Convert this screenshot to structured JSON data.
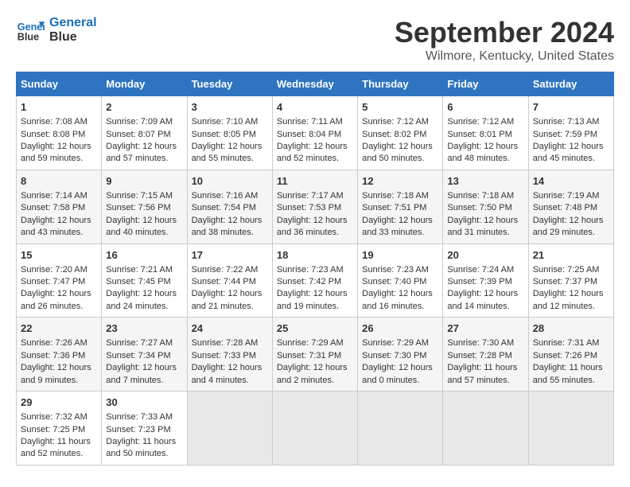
{
  "logo": {
    "line1": "General",
    "line2": "Blue"
  },
  "title": "September 2024",
  "subtitle": "Wilmore, Kentucky, United States",
  "headers": [
    "Sunday",
    "Monday",
    "Tuesday",
    "Wednesday",
    "Thursday",
    "Friday",
    "Saturday"
  ],
  "weeks": [
    [
      {
        "day": "1",
        "sunrise": "7:08 AM",
        "sunset": "8:08 PM",
        "daylight": "12 hours and 59 minutes."
      },
      {
        "day": "2",
        "sunrise": "7:09 AM",
        "sunset": "8:07 PM",
        "daylight": "12 hours and 57 minutes."
      },
      {
        "day": "3",
        "sunrise": "7:10 AM",
        "sunset": "8:05 PM",
        "daylight": "12 hours and 55 minutes."
      },
      {
        "day": "4",
        "sunrise": "7:11 AM",
        "sunset": "8:04 PM",
        "daylight": "12 hours and 52 minutes."
      },
      {
        "day": "5",
        "sunrise": "7:12 AM",
        "sunset": "8:02 PM",
        "daylight": "12 hours and 50 minutes."
      },
      {
        "day": "6",
        "sunrise": "7:12 AM",
        "sunset": "8:01 PM",
        "daylight": "12 hours and 48 minutes."
      },
      {
        "day": "7",
        "sunrise": "7:13 AM",
        "sunset": "7:59 PM",
        "daylight": "12 hours and 45 minutes."
      }
    ],
    [
      {
        "day": "8",
        "sunrise": "7:14 AM",
        "sunset": "7:58 PM",
        "daylight": "12 hours and 43 minutes."
      },
      {
        "day": "9",
        "sunrise": "7:15 AM",
        "sunset": "7:56 PM",
        "daylight": "12 hours and 40 minutes."
      },
      {
        "day": "10",
        "sunrise": "7:16 AM",
        "sunset": "7:54 PM",
        "daylight": "12 hours and 38 minutes."
      },
      {
        "day": "11",
        "sunrise": "7:17 AM",
        "sunset": "7:53 PM",
        "daylight": "12 hours and 36 minutes."
      },
      {
        "day": "12",
        "sunrise": "7:18 AM",
        "sunset": "7:51 PM",
        "daylight": "12 hours and 33 minutes."
      },
      {
        "day": "13",
        "sunrise": "7:18 AM",
        "sunset": "7:50 PM",
        "daylight": "12 hours and 31 minutes."
      },
      {
        "day": "14",
        "sunrise": "7:19 AM",
        "sunset": "7:48 PM",
        "daylight": "12 hours and 29 minutes."
      }
    ],
    [
      {
        "day": "15",
        "sunrise": "7:20 AM",
        "sunset": "7:47 PM",
        "daylight": "12 hours and 26 minutes."
      },
      {
        "day": "16",
        "sunrise": "7:21 AM",
        "sunset": "7:45 PM",
        "daylight": "12 hours and 24 minutes."
      },
      {
        "day": "17",
        "sunrise": "7:22 AM",
        "sunset": "7:44 PM",
        "daylight": "12 hours and 21 minutes."
      },
      {
        "day": "18",
        "sunrise": "7:23 AM",
        "sunset": "7:42 PM",
        "daylight": "12 hours and 19 minutes."
      },
      {
        "day": "19",
        "sunrise": "7:23 AM",
        "sunset": "7:40 PM",
        "daylight": "12 hours and 16 minutes."
      },
      {
        "day": "20",
        "sunrise": "7:24 AM",
        "sunset": "7:39 PM",
        "daylight": "12 hours and 14 minutes."
      },
      {
        "day": "21",
        "sunrise": "7:25 AM",
        "sunset": "7:37 PM",
        "daylight": "12 hours and 12 minutes."
      }
    ],
    [
      {
        "day": "22",
        "sunrise": "7:26 AM",
        "sunset": "7:36 PM",
        "daylight": "12 hours and 9 minutes."
      },
      {
        "day": "23",
        "sunrise": "7:27 AM",
        "sunset": "7:34 PM",
        "daylight": "12 hours and 7 minutes."
      },
      {
        "day": "24",
        "sunrise": "7:28 AM",
        "sunset": "7:33 PM",
        "daylight": "12 hours and 4 minutes."
      },
      {
        "day": "25",
        "sunrise": "7:29 AM",
        "sunset": "7:31 PM",
        "daylight": "12 hours and 2 minutes."
      },
      {
        "day": "26",
        "sunrise": "7:29 AM",
        "sunset": "7:30 PM",
        "daylight": "12 hours and 0 minutes."
      },
      {
        "day": "27",
        "sunrise": "7:30 AM",
        "sunset": "7:28 PM",
        "daylight": "11 hours and 57 minutes."
      },
      {
        "day": "28",
        "sunrise": "7:31 AM",
        "sunset": "7:26 PM",
        "daylight": "11 hours and 55 minutes."
      }
    ],
    [
      {
        "day": "29",
        "sunrise": "7:32 AM",
        "sunset": "7:25 PM",
        "daylight": "11 hours and 52 minutes."
      },
      {
        "day": "30",
        "sunrise": "7:33 AM",
        "sunset": "7:23 PM",
        "daylight": "11 hours and 50 minutes."
      },
      null,
      null,
      null,
      null,
      null
    ]
  ],
  "labels": {
    "sunrise": "Sunrise:",
    "sunset": "Sunset:",
    "daylight": "Daylight:"
  }
}
